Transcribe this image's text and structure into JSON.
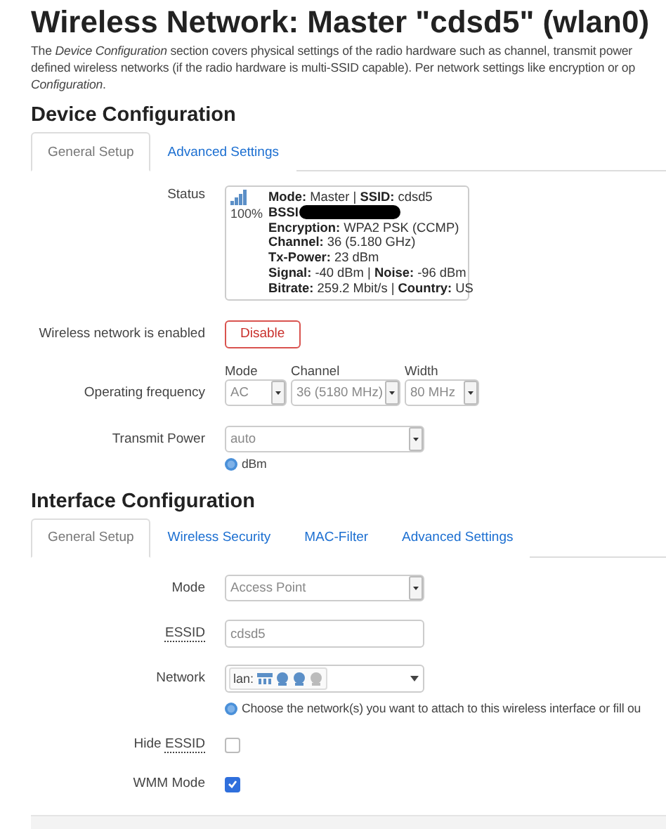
{
  "page_title": "Wireless Network: Master \"cdsd5\" (wlan0)",
  "intro_lines": [
    "The *Device Configuration* section covers physical settings of the radio hardware such as channel, transmit power",
    "defined wireless networks (if the radio hardware is multi-SSID capable). Per network settings like encryption or op",
    "*Configuration*."
  ],
  "sections": [
    {
      "title": "Device Configuration",
      "tabs": [
        {
          "label": "General Setup",
          "selected": true
        },
        {
          "label": "Advanced Settings",
          "selected": false
        }
      ],
      "rows": [
        {
          "kind": "status",
          "label": "Status",
          "signal": "100%",
          "lines": [
            {
              "text": "**Mode:** Master | **SSID:** cdsd5",
              "redacted": false
            },
            {
              "text": "**BSSI**",
              "redacted": true
            },
            {
              "text": "**Encryption:** WPA2 PSK (CCMP)",
              "redacted": false
            },
            {
              "text": "**Channel:** 36 (5.180 GHz)",
              "redacted": false
            },
            {
              "text": "**Tx-Power:** 23 dBm",
              "redacted": false
            },
            {
              "text": "**Signal:** -40 dBm | **Noise:** -96 dBm",
              "redacted": false
            },
            {
              "text": "**Bitrate:** 259.2 Mbit/s | **Country:** US",
              "redacted": false
            }
          ]
        },
        {
          "kind": "button",
          "label": "Wireless network is enabled",
          "button": "Disable"
        },
        {
          "kind": "select_group",
          "label": "Operating frequency",
          "selects": [
            {
              "caption": "Mode",
              "value": "AC"
            },
            {
              "caption": "Channel",
              "value": "36 (5180 MHz)"
            },
            {
              "caption": "Width",
              "value": "80 MHz"
            }
          ]
        },
        {
          "kind": "select",
          "label": "Transmit Power",
          "value": "auto",
          "help": "dBm"
        }
      ]
    },
    {
      "title": "Interface Configuration",
      "tabs": [
        {
          "label": "General Setup",
          "selected": true
        },
        {
          "label": "Wireless Security",
          "selected": false
        },
        {
          "label": "MAC-Filter",
          "selected": false
        },
        {
          "label": "Advanced Settings",
          "selected": false
        }
      ],
      "rows": [
        {
          "kind": "select",
          "label": "Mode",
          "value": "Access Point"
        },
        {
          "kind": "text",
          "abbr": "ESSID",
          "value": "cdsd5"
        },
        {
          "kind": "network",
          "label": "Network",
          "prefix": "lan:",
          "ports": [
            {
              "kind": "switch",
              "active": true
            },
            {
              "kind": "adapter",
              "active": true
            },
            {
              "kind": "adapter",
              "active": true
            },
            {
              "kind": "adapter",
              "active": false
            }
          ],
          "help": "Choose the network(s) you want to attach to this wireless interface or fill ou"
        },
        {
          "kind": "checkbox",
          "label": "Hide",
          "abbr": "ESSID",
          "checked": false
        },
        {
          "kind": "checkbox",
          "label": "WMM Mode",
          "checked": true
        }
      ]
    }
  ]
}
